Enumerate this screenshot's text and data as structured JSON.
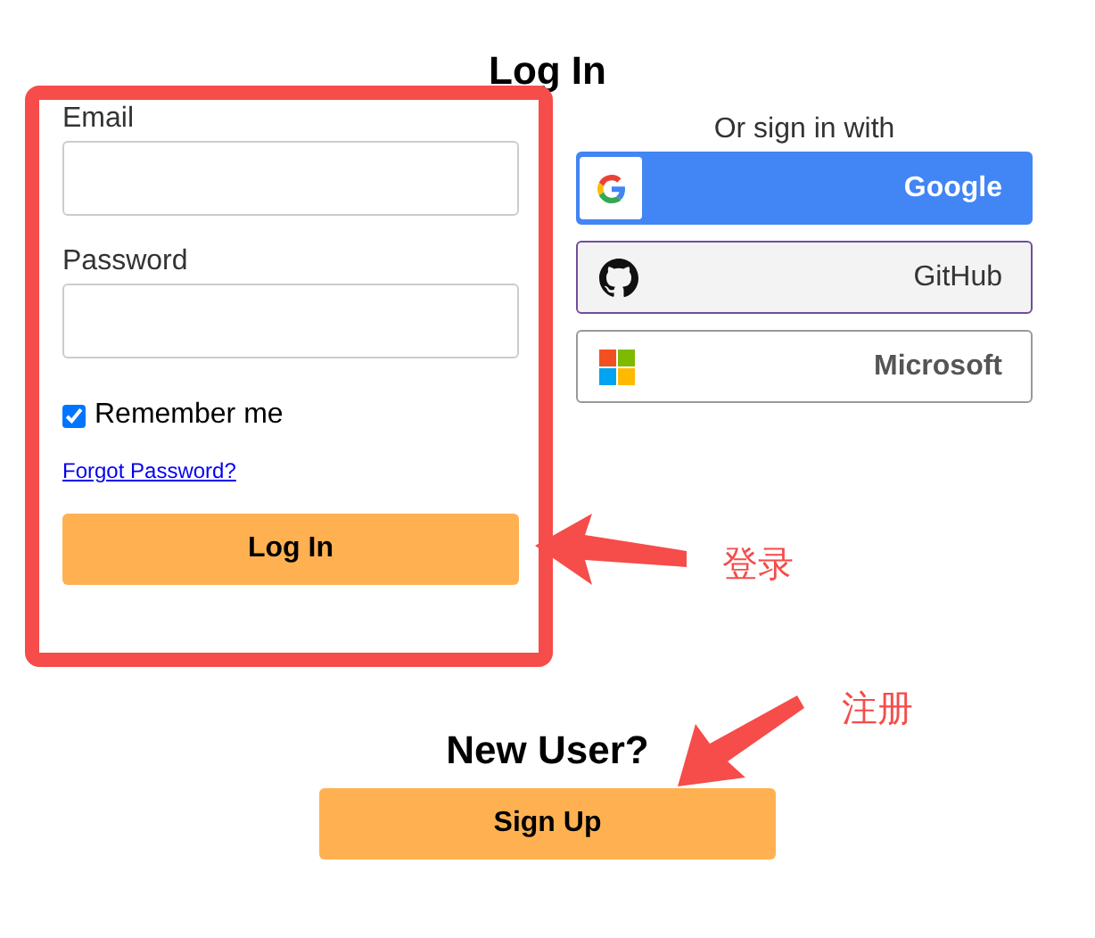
{
  "title": "Log In",
  "fields": [
    {
      "label": "Email"
    },
    {
      "label": "Password"
    }
  ],
  "remember": {
    "label": "Remember me",
    "checked": true
  },
  "forgot_link": "Forgot Password?",
  "login_button": "Log In",
  "social": {
    "heading": "Or sign in with",
    "buttons": [
      {
        "kind": "google",
        "label": "Google"
      },
      {
        "kind": "github",
        "label": "GitHub"
      },
      {
        "kind": "microsoft",
        "label": "Microsoft"
      }
    ]
  },
  "new_user": {
    "heading": "New User?",
    "button": "Sign Up"
  },
  "annotations": [
    {
      "kind": "login",
      "label": "登录"
    },
    {
      "kind": "signup",
      "label": "注册"
    }
  ]
}
